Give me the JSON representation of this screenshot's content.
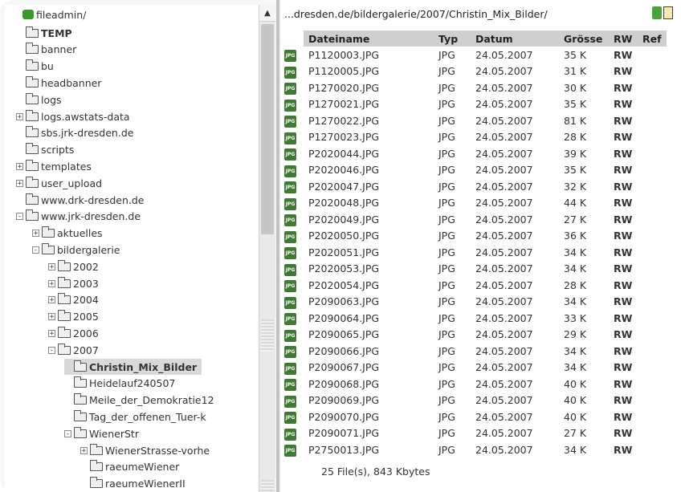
{
  "tree": {
    "root_label": "fileadmin/",
    "items": [
      {
        "label": "TEMP",
        "expander": ""
      },
      {
        "label": "banner",
        "expander": ""
      },
      {
        "label": "bu",
        "expander": ""
      },
      {
        "label": "headbanner",
        "expander": ""
      },
      {
        "label": "logs",
        "expander": ""
      },
      {
        "label": "logs.awstats-data",
        "expander": "+"
      },
      {
        "label": "sbs.jrk-dresden.de",
        "expander": ""
      },
      {
        "label": "scripts",
        "expander": ""
      },
      {
        "label": "templates",
        "expander": "+"
      },
      {
        "label": "user_upload",
        "expander": "+"
      },
      {
        "label": "www.drk-dresden.de",
        "expander": ""
      },
      {
        "label": "www.jrk-dresden.de",
        "expander": "-"
      },
      {
        "label": "aktuelles",
        "expander": "+"
      },
      {
        "label": "bildergalerie",
        "expander": "-"
      },
      {
        "label": "2002",
        "expander": "+"
      },
      {
        "label": "2003",
        "expander": "+"
      },
      {
        "label": "2004",
        "expander": "+"
      },
      {
        "label": "2005",
        "expander": "+"
      },
      {
        "label": "2006",
        "expander": "+"
      },
      {
        "label": "2007",
        "expander": "-"
      },
      {
        "label": "Christin_Mix_Bilder",
        "expander": ""
      },
      {
        "label": "Heidelauf240507",
        "expander": ""
      },
      {
        "label": "Meile_der_Demokratie12",
        "expander": ""
      },
      {
        "label": "Tag_der_offenen_Tuer-k",
        "expander": ""
      },
      {
        "label": "WienerStr",
        "expander": "-"
      },
      {
        "label": "WienerStrasse-vorhe",
        "expander": "+"
      },
      {
        "label": "raeumeWiener",
        "expander": ""
      },
      {
        "label": "raeumeWienerII",
        "expander": ""
      }
    ]
  },
  "path": "...dresden.de/bildergalerie/2007/Christin_Mix_Bilder/",
  "table": {
    "headers": {
      "name": "Dateiname",
      "type": "Typ",
      "date": "Datum",
      "size": "Grösse",
      "rw": "RW",
      "ref": "Ref"
    },
    "rows": [
      {
        "name": "P1120003.JPG",
        "type": "JPG",
        "date": "24.05.2007",
        "size": "35 K",
        "rw": "RW"
      },
      {
        "name": "P1120005.JPG",
        "type": "JPG",
        "date": "24.05.2007",
        "size": "31 K",
        "rw": "RW"
      },
      {
        "name": "P1270020.JPG",
        "type": "JPG",
        "date": "24.05.2007",
        "size": "30 K",
        "rw": "RW"
      },
      {
        "name": "P1270021.JPG",
        "type": "JPG",
        "date": "24.05.2007",
        "size": "35 K",
        "rw": "RW"
      },
      {
        "name": "P1270022.JPG",
        "type": "JPG",
        "date": "24.05.2007",
        "size": "81 K",
        "rw": "RW"
      },
      {
        "name": "P1270023.JPG",
        "type": "JPG",
        "date": "24.05.2007",
        "size": "28 K",
        "rw": "RW"
      },
      {
        "name": "P2020044.JPG",
        "type": "JPG",
        "date": "24.05.2007",
        "size": "39 K",
        "rw": "RW"
      },
      {
        "name": "P2020046.JPG",
        "type": "JPG",
        "date": "24.05.2007",
        "size": "35 K",
        "rw": "RW"
      },
      {
        "name": "P2020047.JPG",
        "type": "JPG",
        "date": "24.05.2007",
        "size": "32 K",
        "rw": "RW"
      },
      {
        "name": "P2020048.JPG",
        "type": "JPG",
        "date": "24.05.2007",
        "size": "44 K",
        "rw": "RW"
      },
      {
        "name": "P2020049.JPG",
        "type": "JPG",
        "date": "24.05.2007",
        "size": "27 K",
        "rw": "RW"
      },
      {
        "name": "P2020050.JPG",
        "type": "JPG",
        "date": "24.05.2007",
        "size": "36 K",
        "rw": "RW"
      },
      {
        "name": "P2020051.JPG",
        "type": "JPG",
        "date": "24.05.2007",
        "size": "34 K",
        "rw": "RW"
      },
      {
        "name": "P2020053.JPG",
        "type": "JPG",
        "date": "24.05.2007",
        "size": "34 K",
        "rw": "RW"
      },
      {
        "name": "P2020054.JPG",
        "type": "JPG",
        "date": "24.05.2007",
        "size": "28 K",
        "rw": "RW"
      },
      {
        "name": "P2090063.JPG",
        "type": "JPG",
        "date": "24.05.2007",
        "size": "34 K",
        "rw": "RW"
      },
      {
        "name": "P2090064.JPG",
        "type": "JPG",
        "date": "24.05.2007",
        "size": "33 K",
        "rw": "RW"
      },
      {
        "name": "P2090065.JPG",
        "type": "JPG",
        "date": "24.05.2007",
        "size": "29 K",
        "rw": "RW"
      },
      {
        "name": "P2090066.JPG",
        "type": "JPG",
        "date": "24.05.2007",
        "size": "34 K",
        "rw": "RW"
      },
      {
        "name": "P2090067.JPG",
        "type": "JPG",
        "date": "24.05.2007",
        "size": "34 K",
        "rw": "RW"
      },
      {
        "name": "P2090068.JPG",
        "type": "JPG",
        "date": "24.05.2007",
        "size": "40 K",
        "rw": "RW"
      },
      {
        "name": "P2090069.JPG",
        "type": "JPG",
        "date": "24.05.2007",
        "size": "40 K",
        "rw": "RW"
      },
      {
        "name": "P2090070.JPG",
        "type": "JPG",
        "date": "24.05.2007",
        "size": "40 K",
        "rw": "RW"
      },
      {
        "name": "P2090071.JPG",
        "type": "JPG",
        "date": "24.05.2007",
        "size": "27 K",
        "rw": "RW"
      },
      {
        "name": "P2750013.JPG",
        "type": "JPG",
        "date": "24.05.2007",
        "size": "34 K",
        "rw": "RW"
      }
    ],
    "icon_text": "JPG",
    "footer": "25 File(s), 843 Kbytes"
  },
  "colors": {
    "rw": "#e01010",
    "header_bg": "#cfcfcf",
    "selected_bg": "#d9d9d9",
    "icon_green": "#3e7a32"
  }
}
